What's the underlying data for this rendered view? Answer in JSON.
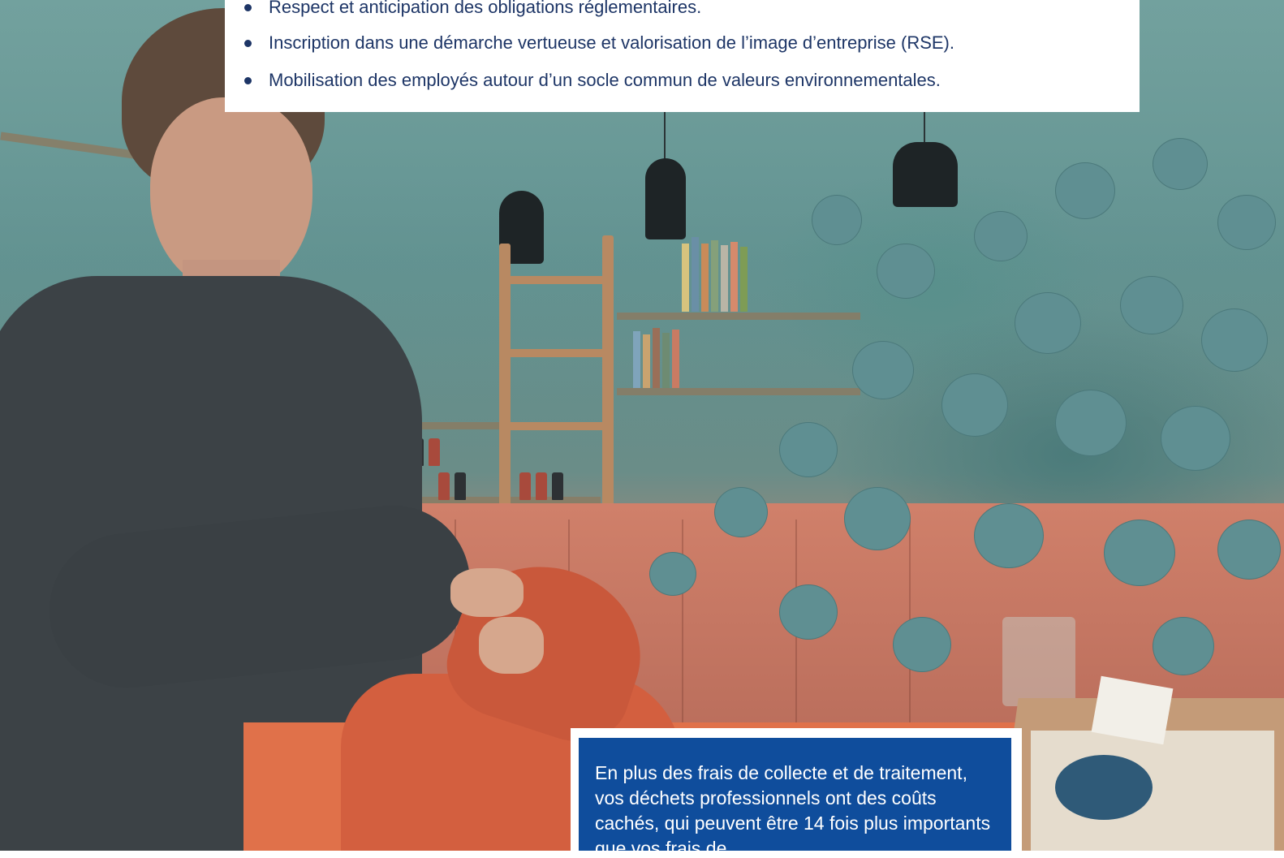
{
  "bullets": [
    "Respect et anticipation des obligations réglementaires.",
    "Inscription dans une démarche vertueuse et valorisation de l’image d’entreprise (RSE).",
    "Mobilisation des employés autour d’un socle commun de valeurs environnementales."
  ],
  "info_box": {
    "text": "En plus des frais de collecte et de traitement, vos déchets professionnels ont des coûts cachés, qui peuvent être 14 fois plus importants que vos frais de"
  },
  "photo": {
    "subject": "woman-wrapping-gift-in-shop-photo"
  },
  "colors": {
    "navy_text": "#1d3566",
    "info_blue": "#0f4d9c",
    "white": "#ffffff"
  }
}
